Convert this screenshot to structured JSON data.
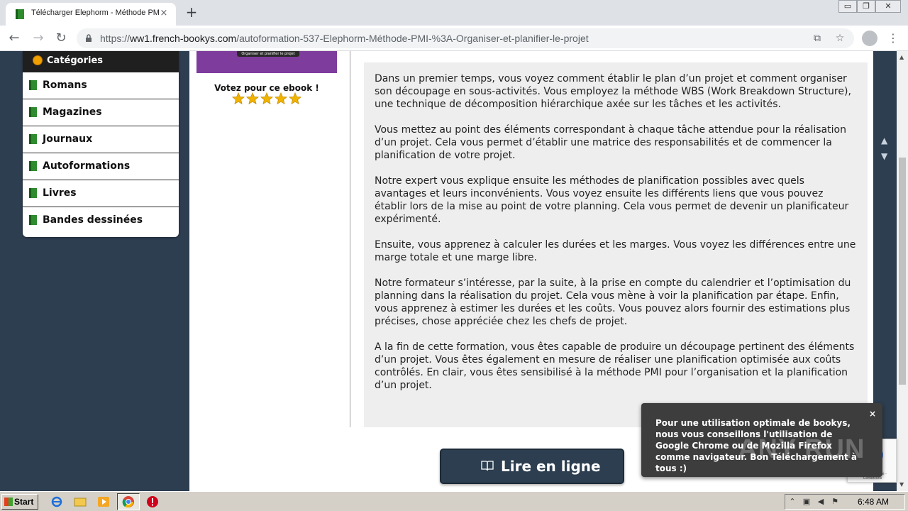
{
  "browser": {
    "tab_title": "Télécharger Elephorm - Méthode PMI",
    "tab_close": "×",
    "new_tab": "+",
    "url_scheme": "https://",
    "url_host": "ww1.french-bookys.com",
    "url_path": "/autoformation-537-Elephorm-Méthode-PMI-%3A-Organiser-et-planifier-le-projet",
    "window_controls": [
      "▭",
      "❐",
      "✕"
    ]
  },
  "sidebar": {
    "header": "Catégories",
    "items": [
      {
        "label": "Romans"
      },
      {
        "label": "Magazines"
      },
      {
        "label": "Journaux"
      },
      {
        "label": "Autoformations"
      },
      {
        "label": "Livres"
      },
      {
        "label": "Bandes dessinées"
      }
    ]
  },
  "book": {
    "cover_caption": "Organiser et planifier le projet",
    "vote_label": "Votez pour ce ebook !",
    "rating": 5,
    "rating_max": 5
  },
  "description": {
    "paragraphs": [
      "Dans un premier temps, vous voyez comment établir le plan d’un projet et comment organiser son découpage en sous-activités. Vous employez la méthode WBS (Work Breakdown Structure), une technique de décomposition hiérarchique axée sur les tâches et les activités.",
      "Vous mettez au point des éléments correspondant à chaque tâche attendue pour la réalisation d’un projet. Cela vous permet d’établir une matrice des responsabilités et de commencer la planification de votre projet.",
      "Notre expert vous explique ensuite les méthodes de planification possibles avec quels avantages et leurs inconvénients. Vous voyez ensuite les différents liens que vous pouvez établir lors de la mise au point de votre planning. Cela vous permet de devenir un planificateur expérimenté.",
      "Ensuite, vous apprenez à calculer les durées et les marges. Vous voyez les différences entre une marge totale et une marge libre.",
      "Notre formateur s’intéresse, par la suite, à la prise en compte du calendrier et l’optimisation du planning dans la réalisation du projet. Cela vous mène à voir la planification par étape. Enfin, vous apprenez à estimer les durées et les coûts. Vous pouvez alors fournir des estimations plus précises, chose appréciée chez les chefs de projet.",
      "A la fin de cette formation, vous êtes capable de produire un découpage pertinent des éléments d’un projet. Vous êtes également en mesure de réaliser une planification optimisée aux coûts contrôlés. En clair, vous êtes sensibilisé à la méthode PMI pour l’organisation et la planification d’un projet."
    ]
  },
  "read_button": {
    "label": "Lire en ligne"
  },
  "toast": {
    "close": "×",
    "message": "Pour une utilisation optimale de bookys, nous vous conseillons l'utilisation de Google Chrome ou de Mozilla Firefox comme navigateur. Bon Téléchargement à tous :)"
  },
  "recaptcha": {
    "text": "Confidentialité - Conditions"
  },
  "watermark": "ANY RUN",
  "taskbar": {
    "start_label": "Start",
    "clock": "6:48 AM"
  },
  "colors": {
    "page_bg": "#2d3e50",
    "sidebar_header": "#1f1f1f",
    "button_bg": "#2c3e50",
    "star": "#f0b400",
    "cover": "#7e3c9c"
  }
}
